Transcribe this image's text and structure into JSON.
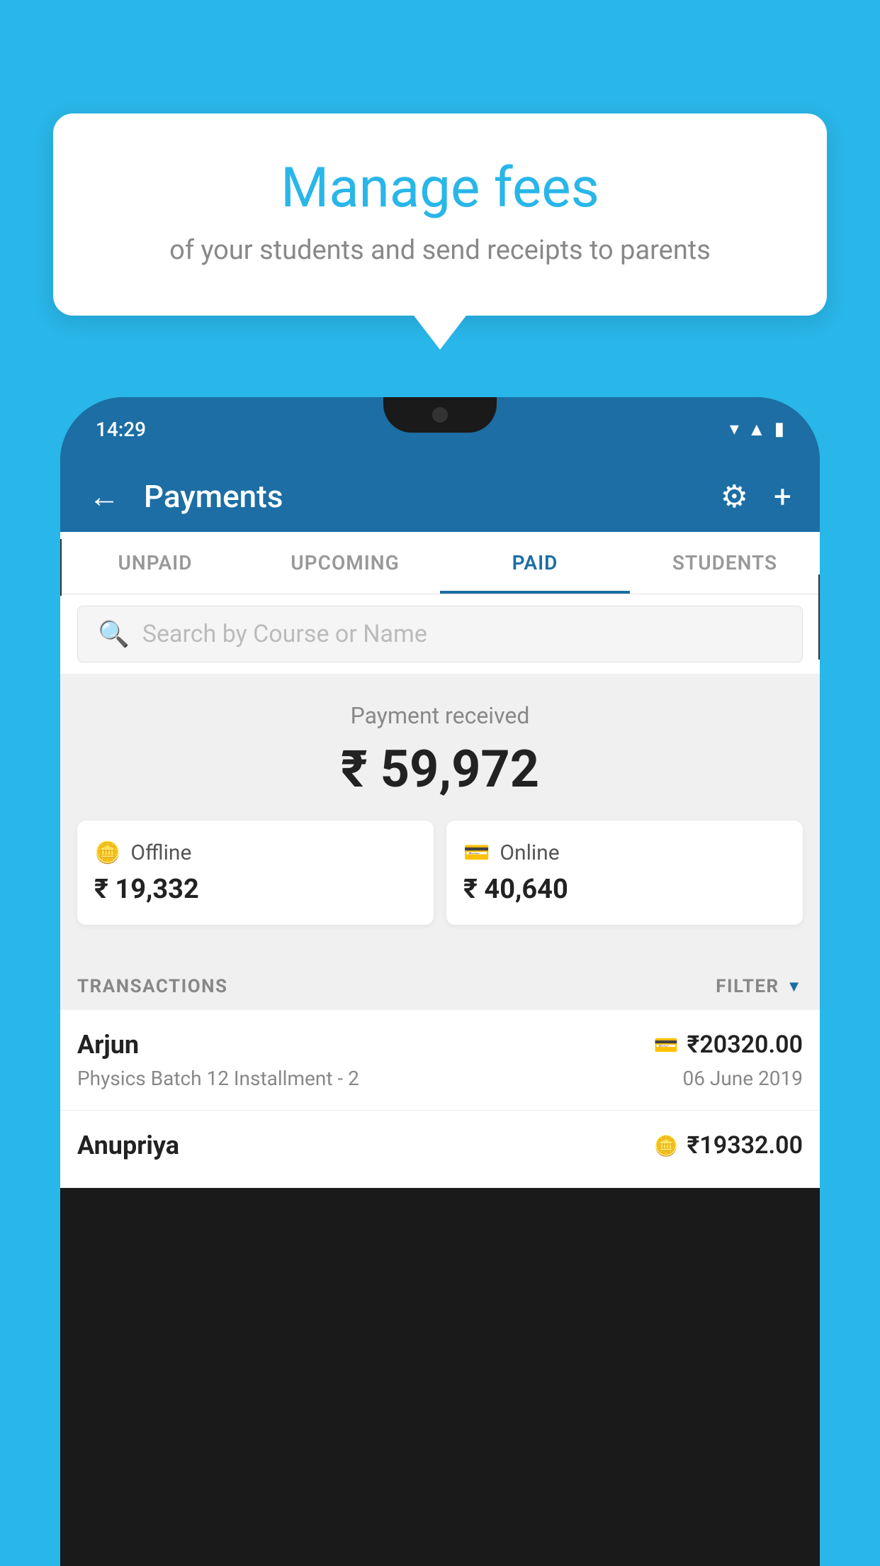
{
  "background_color": "#29b6e8",
  "bubble": {
    "title": "Manage fees",
    "subtitle": "of your students and send receipts to parents"
  },
  "status_bar": {
    "time": "14:29",
    "icons": [
      "wifi",
      "signal",
      "battery"
    ]
  },
  "header": {
    "title": "Payments",
    "back_label": "←",
    "gear_label": "⚙",
    "plus_label": "+"
  },
  "tabs": [
    {
      "label": "UNPAID",
      "active": false
    },
    {
      "label": "UPCOMING",
      "active": false
    },
    {
      "label": "PAID",
      "active": true
    },
    {
      "label": "STUDENTS",
      "active": false
    }
  ],
  "search": {
    "placeholder": "Search by Course or Name"
  },
  "payment_summary": {
    "label": "Payment received",
    "amount": "₹ 59,972",
    "offline": {
      "label": "Offline",
      "amount": "₹ 19,332"
    },
    "online": {
      "label": "Online",
      "amount": "₹ 40,640"
    }
  },
  "transactions": {
    "section_label": "TRANSACTIONS",
    "filter_label": "FILTER",
    "rows": [
      {
        "name": "Arjun",
        "course": "Physics Batch 12 Installment - 2",
        "amount": "₹20320.00",
        "date": "06 June 2019",
        "payment_type": "online"
      },
      {
        "name": "Anupriya",
        "course": "",
        "amount": "₹19332.00",
        "date": "",
        "payment_type": "offline"
      }
    ]
  }
}
